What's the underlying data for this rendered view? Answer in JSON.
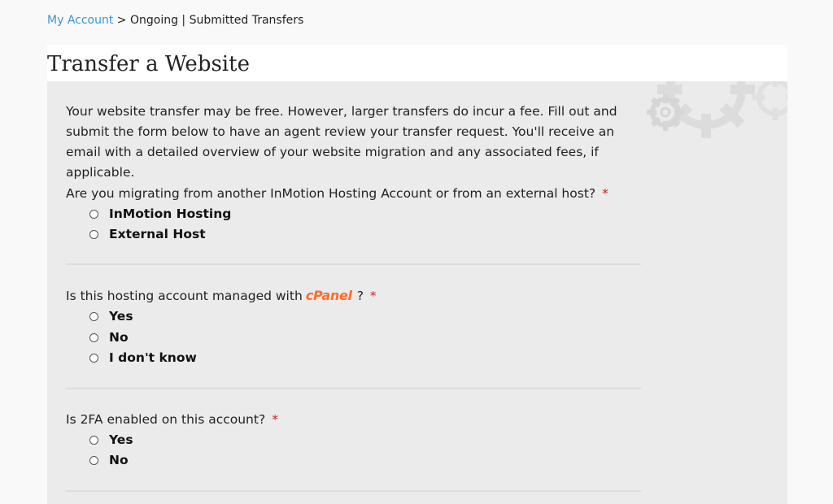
{
  "breadcrumb": {
    "link": "My Account",
    "separator": ">",
    "current": "Ongoing | Submitted Transfers"
  },
  "page_title": "Transfer a Website",
  "intro_text": "Your website transfer may be free. However, larger transfers do incur a fee. Fill out and submit the form below to have an agent review your transfer request. You'll receive an email with a detailed overview of your website migration and any associated fees, if applicable.",
  "questions": [
    {
      "text": "Are you migrating from another InMotion Hosting Account or from an external host?",
      "required_mark": "*",
      "options": [
        "InMotion Hosting",
        "External Host"
      ]
    },
    {
      "text_before": "Is this hosting account managed with",
      "logo_text": "cPanel",
      "text_after": "?",
      "required_mark": "*",
      "options": [
        "Yes",
        "No",
        "I don't know"
      ]
    },
    {
      "text": "Is 2FA enabled on this account?",
      "required_mark": "*",
      "options": [
        "Yes",
        "No"
      ]
    }
  ],
  "colors": {
    "link": "#3d95d6",
    "required": "#d32020",
    "cpanel": "#ff6c2c",
    "panel_bg": "#ebebeb"
  }
}
